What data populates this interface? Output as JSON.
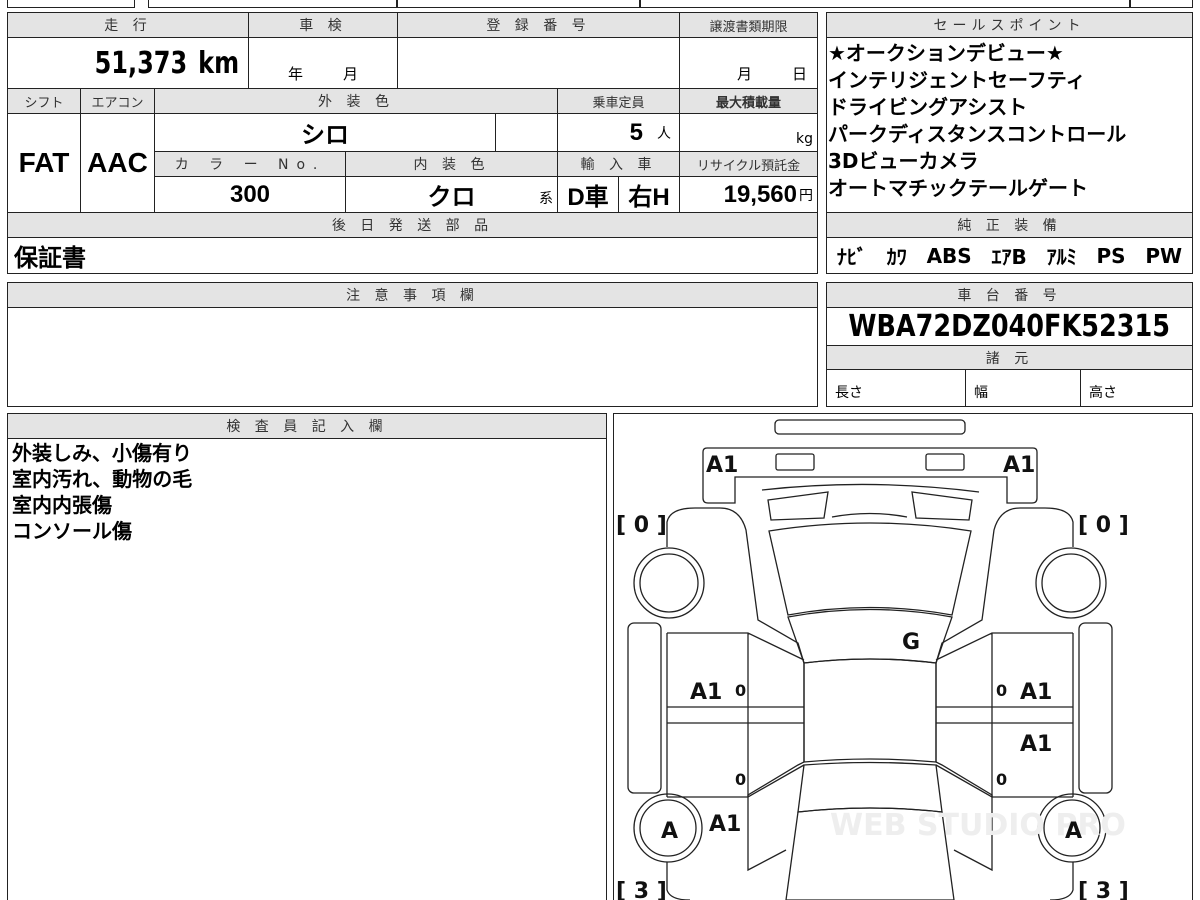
{
  "top_table": {
    "mileage_header": "走 行",
    "mileage": "51,373",
    "mileage_unit": "km",
    "inspection_header": "車 検",
    "inspection_year": "年",
    "inspection_month": "月",
    "reg_header": "登 録 番 号",
    "reg_value": "",
    "transfer_header": "譲渡書類期限",
    "transfer_month": "月",
    "transfer_day": "日",
    "shift_header": "シフト",
    "shift": "FAT",
    "ac_header": "エアコン",
    "ac": "AAC",
    "ext_color_header": "外 装 色",
    "ext_color": "シロ",
    "capacity_header": "乗車定員",
    "capacity": "5",
    "capacity_unit": "人",
    "max_load_header": "最大積載量",
    "max_load_unit": "kg",
    "color_no_header": "カ ラ ー No.",
    "color_no": "300",
    "int_color_header": "内 装 色",
    "int_color": "クロ",
    "int_color_suffix": "系",
    "import_header": "輸 入 車",
    "import_dealer": "D車",
    "steering": "右H",
    "recycle_header": "リサイクル預託金",
    "recycle": "19,560",
    "recycle_unit": "円",
    "later_parts_header": "後 日 発 送 部 品",
    "later_parts": "保証書"
  },
  "sales_points": {
    "header": "セールスポイント",
    "items": [
      "★オークションデビュー★",
      "インテリジェントセーフティ",
      "ドライビングアシスト",
      "パークディスタンスコントロール",
      "3Dビューカメラ",
      "オートマチックテールゲート"
    ]
  },
  "equipment": {
    "header": "純 正 装 備",
    "items": [
      "ﾅﾋﾞ",
      "ｶﾜ",
      "ABS",
      "ｴｱB",
      "ｱﾙﾐ",
      "PS",
      "PW"
    ]
  },
  "notes": {
    "header": "注 意 事 項 欄",
    "text": ""
  },
  "chassis": {
    "header": "車 台 番 号",
    "vin": "WBA72DZ040FK52315",
    "spec_header": "諸 元",
    "length": "長さ",
    "width": "幅",
    "height": "高さ"
  },
  "inspector": {
    "header": "検 査 員 記 入 欄",
    "lines": [
      "外装しみ、小傷有り",
      "室内汚れ、動物の毛",
      "室内内張傷",
      "コンソール傷"
    ]
  },
  "diagram": {
    "front_left": "A1",
    "front_right": "A1",
    "tire_fl": "0",
    "tire_fr": "0",
    "tire_rl": "3",
    "tire_rr": "3",
    "windshield": "G",
    "door_fl": "A1",
    "door_fr": "A1",
    "door_rr": "A1",
    "wheel_rl": "A",
    "wheel_rr": "A",
    "quarter_l": "A1",
    "mark1": "0",
    "mark2": "0",
    "mark3": "0",
    "mark4": "0",
    "watermark": "WEB STUDIO PRO"
  }
}
